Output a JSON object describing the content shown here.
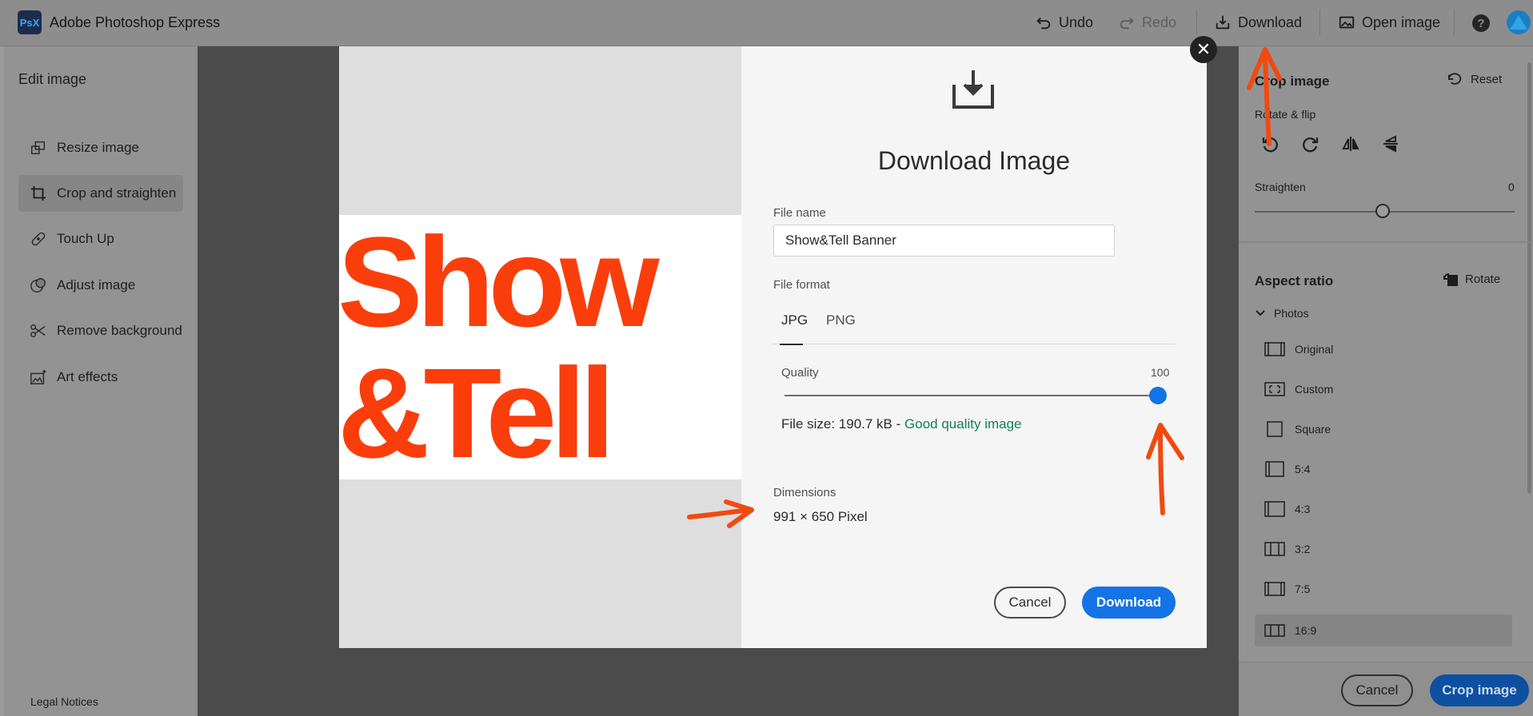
{
  "topbar": {
    "logo_text": "PsX",
    "app_title": "Adobe Photoshop Express",
    "undo_label": "Undo",
    "redo_label": "Redo",
    "download_label": "Download",
    "open_image_label": "Open image",
    "help_symbol": "?"
  },
  "left_panel": {
    "title": "Edit image",
    "items": [
      {
        "label": "Resize image",
        "icon": "resize-icon"
      },
      {
        "label": "Crop and straighten",
        "icon": "crop-icon",
        "selected": true
      },
      {
        "label": "Touch Up",
        "icon": "bandage-icon"
      },
      {
        "label": "Adjust image",
        "icon": "adjust-icon"
      },
      {
        "label": "Remove background",
        "icon": "scissors-icon"
      },
      {
        "label": "Art effects",
        "icon": "art-effects-icon"
      }
    ],
    "legal": "Legal Notices"
  },
  "right_panel": {
    "crop_title": "Crop image",
    "reset_label": "Reset",
    "rotate_flip_label": "Rotate & flip",
    "straighten_label": "Straighten",
    "straighten_value": "0",
    "aspect_title": "Aspect ratio",
    "rotate_label": "Rotate",
    "photos_label": "Photos",
    "ratios": [
      "Original",
      "Custom",
      "Square",
      "5:4",
      "4:3",
      "3:2",
      "7:5",
      "16:9"
    ],
    "selected_ratio": "16:9",
    "cancel_label": "Cancel",
    "crop_button_label": "Crop image"
  },
  "dialog": {
    "title": "Download Image",
    "file_name_label": "File name",
    "file_name_value": "Show&Tell Banner",
    "file_format_label": "File format",
    "format_jpg": "JPG",
    "format_png": "PNG",
    "selected_format": "JPG",
    "quality_label": "Quality",
    "quality_value": "100",
    "file_size_text": "File size: 190.7 kB -",
    "quality_note": "Good quality image",
    "dimensions_label": "Dimensions",
    "dimensions_value": "991 × 650 Pixel",
    "cancel_label": "Cancel",
    "download_label": "Download",
    "close_symbol": "✕",
    "preview_line1": "Show",
    "preview_line2": "&Tell"
  },
  "colors": {
    "accent_blue": "#1473e6",
    "banner_orange": "#fa3e0b",
    "good_green": "#12805c",
    "annotation_orange": "#f04a12"
  }
}
